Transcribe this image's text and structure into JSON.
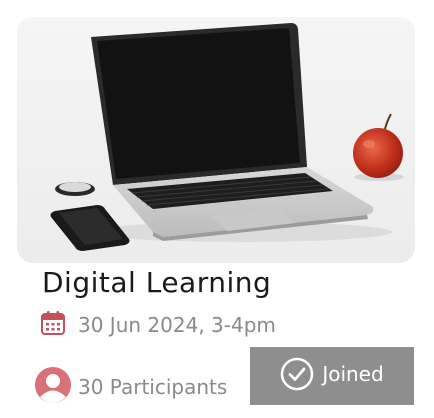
{
  "event": {
    "title": "Digital Learning",
    "date": "30 Jun 2024, 3-4pm",
    "participants": "30 Participants",
    "status_label": "Joined"
  },
  "icons": {
    "date": "calendar-icon",
    "participants": "user-avatar-icon",
    "status": "check-circle-icon"
  },
  "colors": {
    "calendar_icon": "#c4505a",
    "avatar_icon": "#d9707a",
    "joined_button": "#8e8e8e",
    "title_text": "#1a1a1a",
    "meta_text": "#8a8a8a"
  }
}
